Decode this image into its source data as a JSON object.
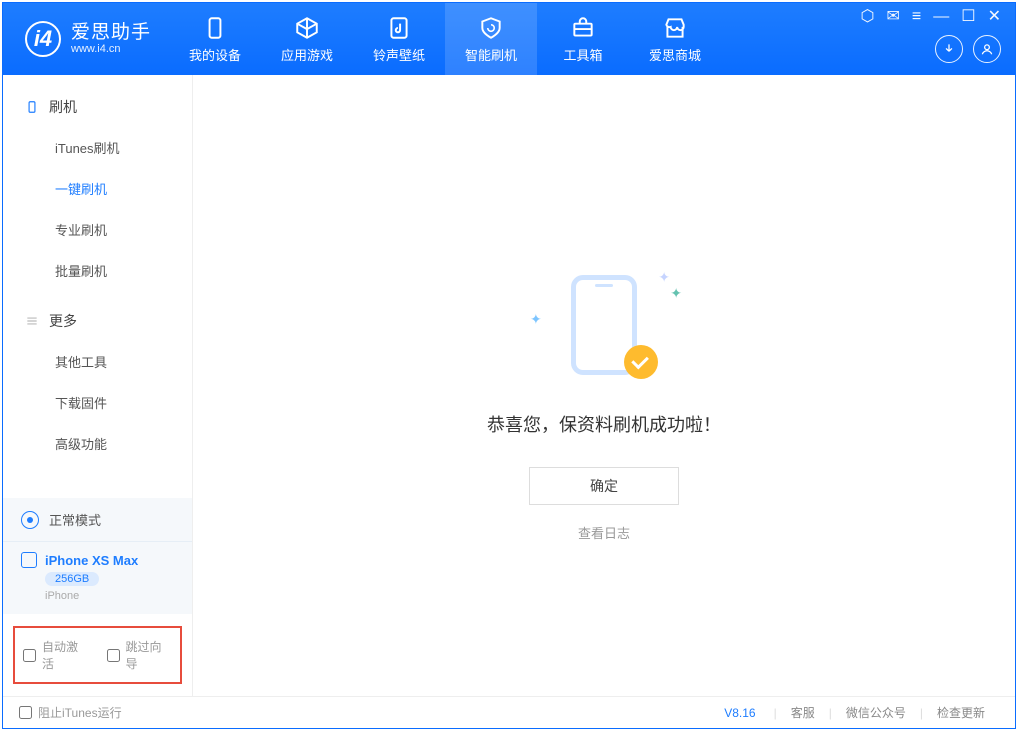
{
  "app": {
    "name_cn": "爱思助手",
    "url": "www.i4.cn"
  },
  "tabs": [
    {
      "id": "device",
      "label": "我的设备"
    },
    {
      "id": "apps",
      "label": "应用游戏"
    },
    {
      "id": "ringtone",
      "label": "铃声壁纸"
    },
    {
      "id": "flash",
      "label": "智能刷机",
      "active": true
    },
    {
      "id": "toolbox",
      "label": "工具箱"
    },
    {
      "id": "store",
      "label": "爱思商城"
    }
  ],
  "sidebar": {
    "group_flash": "刷机",
    "flash_items": [
      "iTunes刷机",
      "一键刷机",
      "专业刷机",
      "批量刷机"
    ],
    "active_index": 1,
    "group_more": "更多",
    "more_items": [
      "其他工具",
      "下载固件",
      "高级功能"
    ]
  },
  "mode": {
    "label": "正常模式"
  },
  "device": {
    "name": "iPhone XS Max",
    "capacity": "256GB",
    "sub": "iPhone"
  },
  "options": {
    "auto_activate": "自动激活",
    "skip_wizard": "跳过向导"
  },
  "main": {
    "success_text": "恭喜您，保资料刷机成功啦！",
    "ok": "确定",
    "view_log": "查看日志"
  },
  "footer": {
    "block_itunes": "阻止iTunes运行",
    "version": "V8.16",
    "links": [
      "客服",
      "微信公众号",
      "检查更新"
    ]
  }
}
